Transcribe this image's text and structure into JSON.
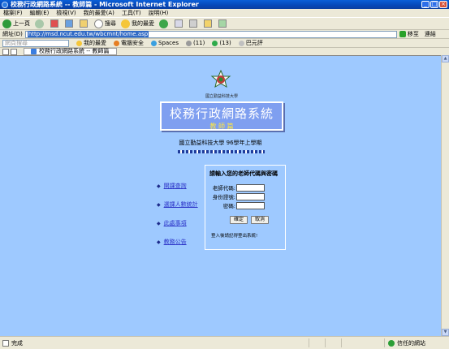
{
  "window": {
    "title": "校務行政網路系統 -- 教師篇 - Microsoft Internet Explorer",
    "minimize": "_",
    "maximize": "□",
    "close": "×"
  },
  "menu": [
    "檔案(F)",
    "編輯(E)",
    "檢視(V)",
    "我的最愛(A)",
    "工具(T)",
    "說明(H)"
  ],
  "toolbar": {
    "back": "上一頁",
    "search": "搜尋",
    "favorites": "我的最愛"
  },
  "address": {
    "label": "網址(D)",
    "url": "http://msd.ncut.edu.tw/wbcmnt/home.asp",
    "go": "移至",
    "links": "連結"
  },
  "linksbar": {
    "search_placeholder": "網頁搜尋",
    "items": [
      "我的最愛",
      "電腦安全",
      "Spaces",
      "(11)",
      "(13)",
      "巴元評"
    ]
  },
  "tab": {
    "label": "校務行政網路系統 -- 教師篇"
  },
  "page": {
    "school_name_small": "國立勤益科技大學",
    "banner_title": "校務行政網路系統",
    "banner_subtitle": "教 師 篇",
    "semester": "國立勤益科技大學 96學年上學期",
    "nav": [
      {
        "label": "開課查詢"
      },
      {
        "label": "選課人數統計"
      },
      {
        "label": "此處事項"
      },
      {
        "label": "教務公告"
      }
    ],
    "login": {
      "title": "請輸入您的老師代碼與密碼",
      "teacher_code_label": "老師代碼:",
      "id_label": "身份證號:",
      "password_label": "密碼:",
      "confirm": "確定",
      "cancel": "取消",
      "hint": "登入後請記得登出系統!"
    }
  },
  "status": {
    "left": "完成",
    "zone": "信任的網站"
  }
}
